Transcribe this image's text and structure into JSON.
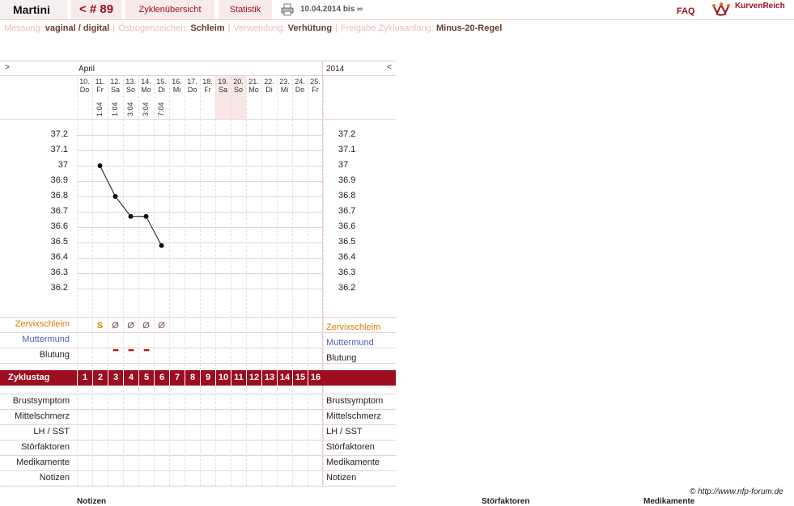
{
  "topbar": {
    "name": "Martini",
    "cycle": "< # 89",
    "overview": "Zyklenübersicht",
    "stats": "Statistik",
    "date_range": "10.04.2014 bis ∞",
    "faq": "FAQ",
    "brand": "KurvenReich"
  },
  "info": {
    "measure_label": "Messung:",
    "measure_value": "vaginal / digital",
    "estrogen_label": "Östrogenzeichen:",
    "estrogen_value": "Schleim",
    "usage_label": "Verwendung:",
    "usage_value": "Verhütung",
    "release_label": "Freigabe Zyklusanfang:",
    "release_value": "Minus-20-Regel"
  },
  "chart": {
    "nav_prev": ">",
    "nav_next": "<",
    "month": "April",
    "year": "2014",
    "days": [
      {
        "d": "10.",
        "w": "Do",
        "date": "",
        "weekend": false
      },
      {
        "d": "11.",
        "w": "Fr",
        "date": "1:04",
        "weekend": false
      },
      {
        "d": "12.",
        "w": "Sa",
        "date": "1:04",
        "weekend": true
      },
      {
        "d": "13.",
        "w": "So",
        "date": "3:04",
        "weekend": true
      },
      {
        "d": "14.",
        "w": "Mo",
        "date": "3:04",
        "weekend": false
      },
      {
        "d": "15.",
        "w": "Di",
        "date": "7:04",
        "weekend": false
      },
      {
        "d": "16.",
        "w": "Mi",
        "date": "",
        "weekend": false
      },
      {
        "d": "17.",
        "w": "Do",
        "date": "",
        "weekend": false
      },
      {
        "d": "18.",
        "w": "Fr",
        "date": "",
        "weekend": false
      },
      {
        "d": "19.",
        "w": "Sa",
        "date": "",
        "weekend": true
      },
      {
        "d": "20.",
        "w": "So",
        "date": "",
        "weekend": true
      },
      {
        "d": "21.",
        "w": "Mo",
        "date": "",
        "weekend": false
      },
      {
        "d": "22.",
        "w": "Di",
        "date": "",
        "weekend": false
      },
      {
        "d": "23.",
        "w": "Mi",
        "date": "",
        "weekend": false
      },
      {
        "d": "24.",
        "w": "Do",
        "date": "",
        "weekend": false
      },
      {
        "d": "25.",
        "w": "Fr",
        "date": "",
        "weekend": false
      }
    ],
    "temp_ticks": [
      "37.2",
      "37.1",
      "37",
      "36.9",
      "36.8",
      "36.7",
      "36.6",
      "36.5",
      "36.4",
      "36.3",
      "36.2"
    ],
    "temps": [
      null,
      37.0,
      36.8,
      36.67,
      36.67,
      36.48
    ],
    "rows_top": [
      {
        "label": "Zervixschleim",
        "color": "#e07b00"
      },
      {
        "label": "Muttermund",
        "color": "#4a5fc0"
      },
      {
        "label": "Blutung",
        "color": "#222222"
      }
    ],
    "mucus": [
      "",
      "S",
      "Ø",
      "Ø",
      "Ø",
      "Ø"
    ],
    "bleeding": [
      "",
      "",
      "•••",
      "•••",
      "•••",
      ""
    ],
    "cycle_label": "Zyklustag",
    "cycle_days": [
      "1",
      "2",
      "3",
      "4",
      "5",
      "6",
      "7",
      "8",
      "9",
      "10",
      "11",
      "12",
      "13",
      "14",
      "15",
      "16"
    ],
    "rows_bottom": [
      "Brustsymptom",
      "Mittelschmerz",
      "LH / SST",
      "Störfaktoren",
      "Medikamente",
      "Notizen"
    ]
  },
  "footer": {
    "credit": "© http://www.nfp-forum.de",
    "notes": "Notizen",
    "disturb": "Störfaktoren",
    "meds": "Medikamente"
  },
  "colors": {
    "accent": "#9b0d1f",
    "bleed": "#cc0000",
    "mucus": "#e07b00"
  }
}
